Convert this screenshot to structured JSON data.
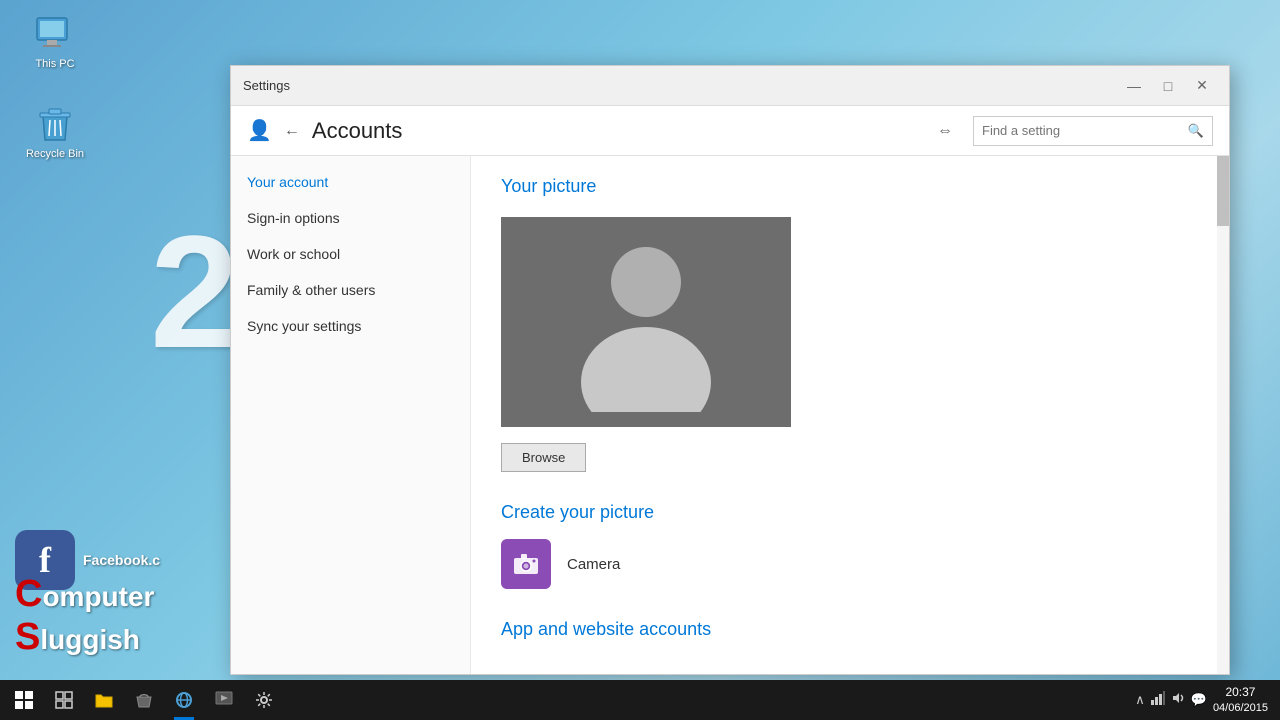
{
  "desktop": {
    "icons": [
      {
        "id": "this-pc",
        "label": "This PC"
      },
      {
        "id": "recycle-bin",
        "label": "Recycle Bin"
      }
    ],
    "big_number": "2",
    "facebook_url": "Facebook.c",
    "watermark_line1": "Computer",
    "watermark_line2": "Sluggish"
  },
  "window": {
    "title": "Settings",
    "controls": {
      "minimize": "—",
      "maximize": "□",
      "close": "✕"
    }
  },
  "header": {
    "icon": "👤",
    "back_arrow": "←",
    "title": "Accounts",
    "pin_icon": "📌",
    "search_placeholder": "Find a setting"
  },
  "sidebar": {
    "items": [
      {
        "id": "your-account",
        "label": "Your account",
        "active": true
      },
      {
        "id": "sign-in-options",
        "label": "Sign-in options",
        "active": false
      },
      {
        "id": "work-or-school",
        "label": "Work or school",
        "active": false
      },
      {
        "id": "family-other-users",
        "label": "Family & other users",
        "active": false
      },
      {
        "id": "sync-settings",
        "label": "Sync your settings",
        "active": false
      }
    ]
  },
  "main": {
    "picture_section_title": "Your picture",
    "browse_button": "Browse",
    "create_section_title": "Create your picture",
    "camera_label": "Camera",
    "app_accounts_title": "App and website accounts"
  },
  "taskbar": {
    "start_icon": "⊞",
    "items": [
      {
        "id": "task-view",
        "icon": "⧉",
        "active": false
      },
      {
        "id": "file-explorer",
        "icon": "📁",
        "active": false
      },
      {
        "id": "store",
        "icon": "🛍",
        "active": false
      },
      {
        "id": "browser",
        "icon": "🌐",
        "active": true
      },
      {
        "id": "media",
        "icon": "🎬",
        "active": false
      },
      {
        "id": "settings-tb",
        "icon": "⚙",
        "active": false
      }
    ],
    "system_icons": {
      "hide_arrow": "∧",
      "network": "📶",
      "volume": "🔊",
      "chat": "💬"
    },
    "time": "20:37",
    "date": "04/06/2015"
  }
}
